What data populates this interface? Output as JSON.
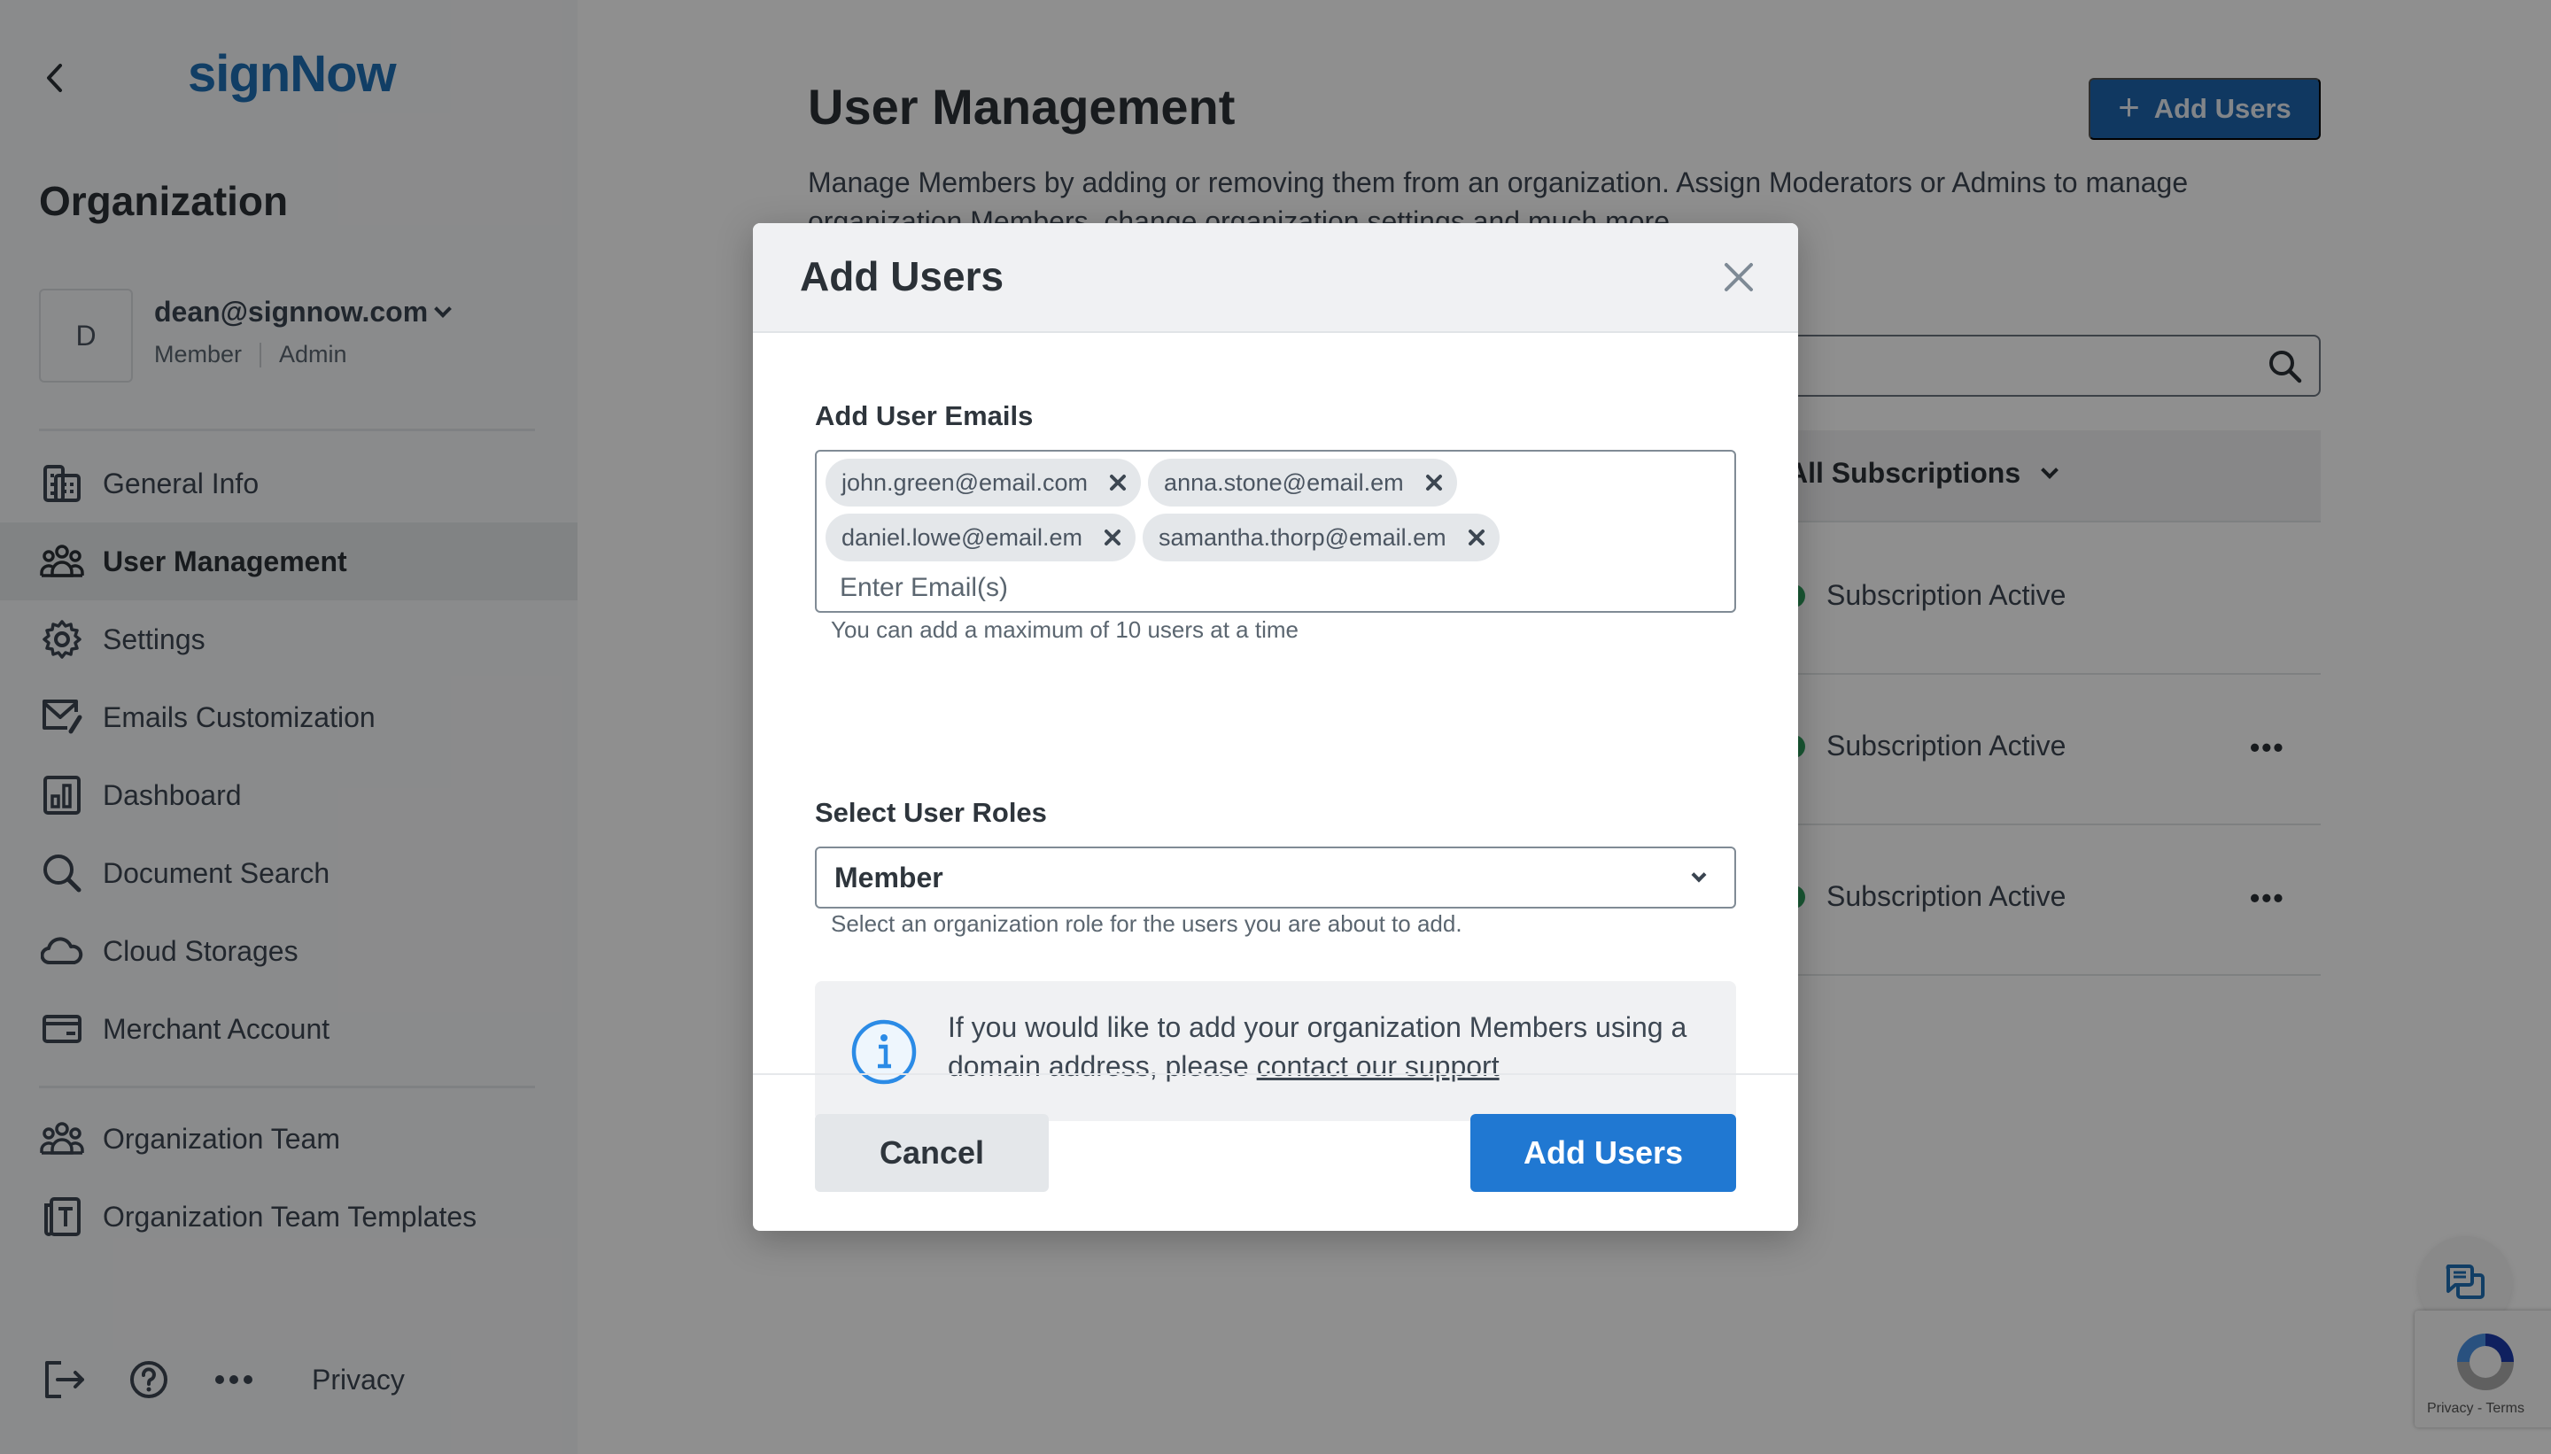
{
  "sidebar": {
    "logo": "signNow",
    "section_title": "Organization",
    "account": {
      "avatar_initial": "D",
      "email": "dean@signnow.com",
      "roles": [
        "Member",
        "Admin"
      ]
    },
    "items": [
      {
        "label": "General Info",
        "icon": "building-icon",
        "active": false
      },
      {
        "label": "User Management",
        "icon": "users-icon",
        "active": true
      },
      {
        "label": "Settings",
        "icon": "gear-icon",
        "active": false
      },
      {
        "label": "Emails Customization",
        "icon": "mail-brush-icon",
        "active": false
      },
      {
        "label": "Dashboard",
        "icon": "chart-icon",
        "active": false
      },
      {
        "label": "Document Search",
        "icon": "search-icon",
        "active": false
      },
      {
        "label": "Cloud Storages",
        "icon": "cloud-icon",
        "active": false
      },
      {
        "label": "Merchant Account",
        "icon": "card-icon",
        "active": false
      }
    ],
    "team_items": [
      {
        "label": "Organization Team",
        "icon": "team-icon"
      },
      {
        "label": "Organization Team Templates",
        "icon": "template-icon"
      }
    ],
    "footer": {
      "privacy_label": "Privacy"
    }
  },
  "main": {
    "title": "User Management",
    "description": "Manage Members by adding or removing them from an organization. Assign Moderators or Admins to manage organization Members, change organization settings and much more.",
    "add_users_label": "Add Users",
    "table": {
      "filter_label": "All Subscriptions",
      "rows": [
        {
          "status": "Subscription Active",
          "has_menu": false
        },
        {
          "status": "Subscription Active",
          "has_menu": true
        },
        {
          "status": "Subscription Active",
          "has_menu": true
        }
      ]
    }
  },
  "modal": {
    "title": "Add Users",
    "emails_label": "Add User Emails",
    "emails": [
      "john.green@email.com",
      "anna.stone@email.em",
      "daniel.lowe@email.em",
      "samantha.thorp@email.em"
    ],
    "email_placeholder": "Enter Email(s)",
    "email_hint": "You can add a maximum of 10 users at a time",
    "roles_label": "Select User Roles",
    "role_selected": "Member",
    "roles_hint": "Select an organization role for the users you are about to add.",
    "info_text": "If you would like to add your organization Members using a domain address, please ",
    "info_link": "contact our support",
    "cancel_label": "Cancel",
    "submit_label": "Add Users"
  },
  "recaptcha": {
    "text": "Privacy - Terms"
  },
  "colors": {
    "brand_blue": "#1f6fb5",
    "primary_button": "#2078d2",
    "status_active": "#2e9e5e",
    "info_icon": "#2b8be6"
  }
}
